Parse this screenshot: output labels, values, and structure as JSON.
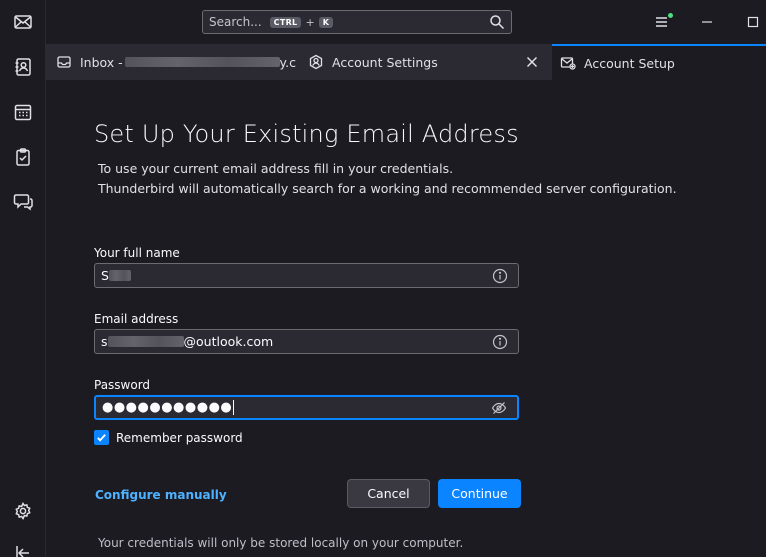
{
  "titlebar": {
    "search_placeholder": "Search...",
    "shortcut_key1": "CTRL",
    "shortcut_plus": "+",
    "shortcut_key2": "K"
  },
  "tabs": [
    {
      "label_prefix": "Inbox - ",
      "label_suffix": "y.c",
      "icon": "inbox-icon"
    },
    {
      "label": "Account Settings",
      "icon": "account-settings-icon"
    },
    {
      "label": "Account Setup",
      "icon": "mail-setup-icon",
      "active": true
    }
  ],
  "setup": {
    "title": "Set Up Your Existing Email Address",
    "description_line1": "To use your current email address fill in your credentials.",
    "description_line2": "Thunderbird will automatically search for a working and recommended server configuration.",
    "full_name_label": "Your full name",
    "full_name_value": "S",
    "email_label": "Email address",
    "email_value_prefix": "s",
    "email_value_suffix": "@outlook.com",
    "password_label": "Password",
    "password_value": "●●●●●●●●●●●",
    "remember_label": "Remember password",
    "remember_checked": true,
    "configure_manually": "Configure manually",
    "cancel_label": "Cancel",
    "continue_label": "Continue",
    "footnote": "Your credentials will only be stored locally on your computer."
  },
  "colors": {
    "accent": "#0a84ff",
    "link": "#4db2ff",
    "background": "#1c1b22",
    "surface": "#2b2a33"
  }
}
